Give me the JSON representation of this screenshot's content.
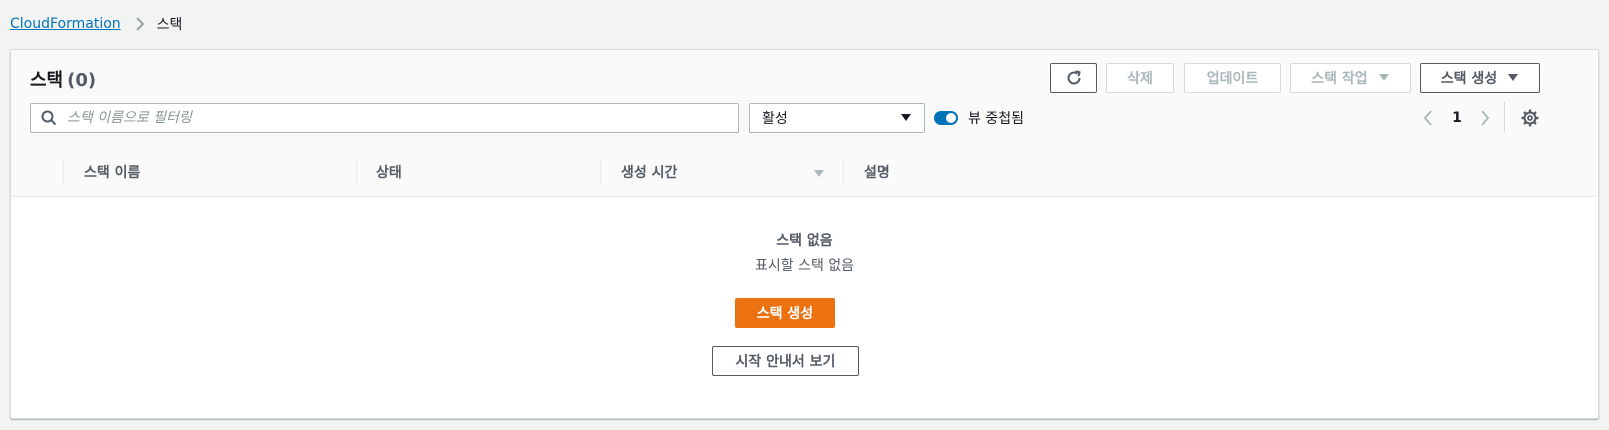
{
  "breadcrumb": {
    "link": "CloudFormation",
    "current": "스택"
  },
  "panel": {
    "title": "스택",
    "count": "(0)"
  },
  "toolbar": {
    "refresh_icon": "refresh-icon",
    "delete_label": "삭제",
    "update_label": "업데이트",
    "stack_actions_label": "스택 작업",
    "create_stack_label": "스택 생성"
  },
  "filter": {
    "search_placeholder": "스택 이름으로 필터링",
    "status_value": "활성",
    "nested_view_label": "뷰 중첩됨",
    "nested_view_on": true
  },
  "pagination": {
    "current_page": "1"
  },
  "table": {
    "columns": [
      "스택 이름",
      "상태",
      "생성 시간",
      "설명"
    ],
    "sorted_column": "생성 시간",
    "sort_direction": "descending",
    "rows": []
  },
  "empty_state": {
    "title": "스택 없음",
    "subtitle": "표시할 스택 없음",
    "create_button": "스택 생성",
    "guide_button": "시작 안내서 보기"
  },
  "colors": {
    "link": "#0073bb",
    "primary": "#ec7211",
    "toggle": "#0073bb",
    "text": "#16191f",
    "muted": "#545b64"
  }
}
